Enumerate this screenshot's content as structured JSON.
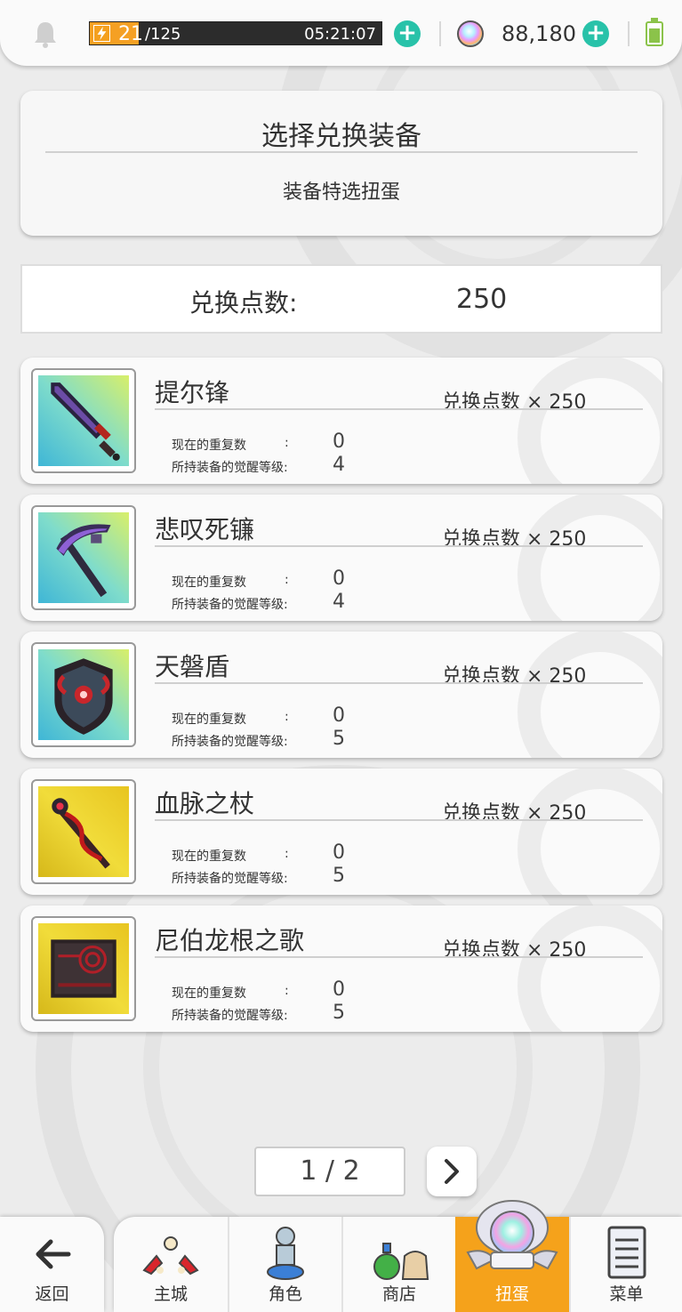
{
  "topbar": {
    "stamina_current": "21",
    "stamina_max": "/125",
    "stamina_fraction": 0.168,
    "stamina_timer": "05:21:07",
    "gems": "88,180"
  },
  "header": {
    "title": "选择兑换装备",
    "subtitle": "装备特选扭蛋"
  },
  "points": {
    "label": "兑换点数:",
    "value": "250"
  },
  "items": [
    {
      "name": "提尔锋",
      "cost": "兑换点数 × 250",
      "dup_label": "现在的重复数",
      "dup_value": "0",
      "awaken_label": "所持装备的觉醒等级:",
      "awaken_value": "4",
      "icon": "dark-sword-icon"
    },
    {
      "name": "悲叹死镰",
      "cost": "兑换点数 × 250",
      "dup_label": "现在的重复数",
      "dup_value": "0",
      "awaken_label": "所持装备的觉醒等级:",
      "awaken_value": "4",
      "icon": "scythe-icon"
    },
    {
      "name": "天磐盾",
      "cost": "兑换点数 × 250",
      "dup_label": "现在的重复数",
      "dup_value": "0",
      "awaken_label": "所持装备的觉醒等级:",
      "awaken_value": "5",
      "icon": "shield-icon"
    },
    {
      "name": "血脉之杖",
      "cost": "兑换点数 × 250",
      "dup_label": "现在的重复数",
      "dup_value": "0",
      "awaken_label": "所持装备的觉醒等级:",
      "awaken_value": "5",
      "icon": "staff-icon"
    },
    {
      "name": "尼伯龙根之歌",
      "cost": "兑换点数 × 250",
      "dup_label": "现在的重复数",
      "dup_value": "0",
      "awaken_label": "所持装备的觉醒等级:",
      "awaken_value": "5",
      "icon": "tome-icon"
    }
  ],
  "stat_colon": ":",
  "pagination": {
    "label": "1 / 2"
  },
  "nav": {
    "back": "返回",
    "items": [
      "主城",
      "角色",
      "商店",
      "扭蛋",
      "菜单"
    ],
    "active": "扭蛋"
  },
  "colors": {
    "accent_orange": "#f5a21b",
    "plus_teal": "#28c2a9",
    "battery_green": "#8bc34a"
  }
}
